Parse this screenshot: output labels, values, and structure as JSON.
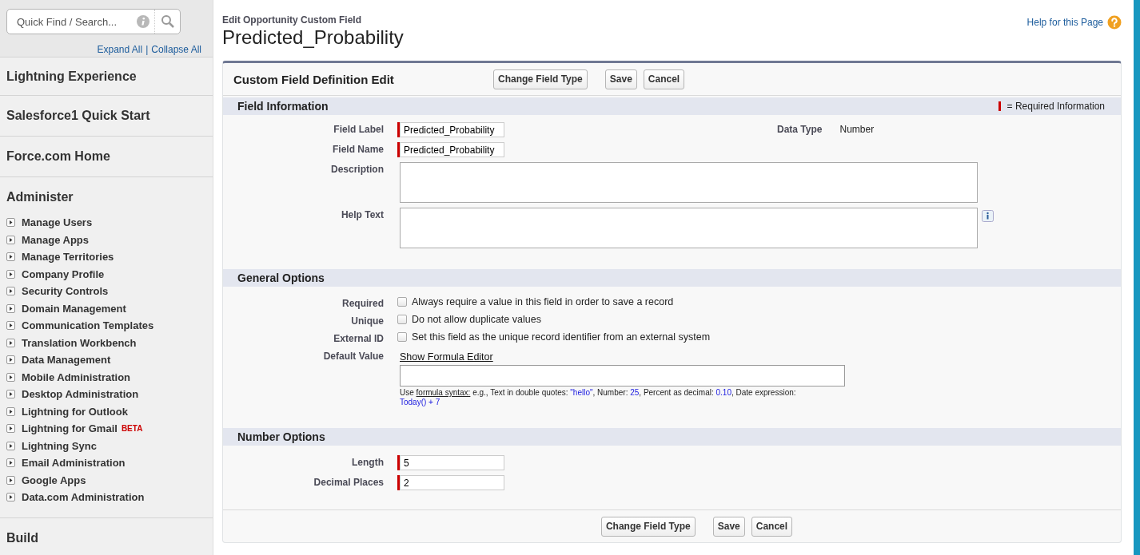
{
  "search": {
    "placeholder": "Quick Find / Search..."
  },
  "tree_links": {
    "expand": "Expand All",
    "separator": "|",
    "collapse": "Collapse All"
  },
  "sidebar": {
    "sections": [
      {
        "title": "Lightning Experience"
      },
      {
        "title": "Salesforce1 Quick Start"
      },
      {
        "title": "Force.com Home"
      },
      {
        "title": "Administer",
        "items": [
          {
            "label": "Manage Users"
          },
          {
            "label": "Manage Apps"
          },
          {
            "label": "Manage Territories"
          },
          {
            "label": "Company Profile"
          },
          {
            "label": "Security Controls"
          },
          {
            "label": "Domain Management"
          },
          {
            "label": "Communication Templates"
          },
          {
            "label": "Translation Workbench"
          },
          {
            "label": "Data Management"
          },
          {
            "label": "Mobile Administration"
          },
          {
            "label": "Desktop Administration"
          },
          {
            "label": "Lightning for Outlook"
          },
          {
            "label": "Lightning for Gmail",
            "badge": "BETA"
          },
          {
            "label": "Lightning Sync"
          },
          {
            "label": "Email Administration"
          },
          {
            "label": "Google Apps"
          },
          {
            "label": "Data.com Administration"
          }
        ]
      },
      {
        "title": "Build"
      }
    ]
  },
  "header": {
    "subtitle": "Edit Opportunity Custom Field",
    "title": "Predicted_Probability",
    "help_link": "Help for this Page"
  },
  "panel": {
    "title": "Custom Field Definition Edit",
    "buttons": [
      "Change Field Type",
      "Save",
      "Cancel"
    ],
    "sections": [
      {
        "title": "Field Information",
        "legend": "= Required Information",
        "rows": [
          {
            "kind": "text",
            "label": "Field Label",
            "value": "Predicted_Probability",
            "required": true,
            "side_label": "Data Type",
            "side_value": "Number"
          },
          {
            "kind": "text",
            "label": "Field Name",
            "value": "Predicted_Probability",
            "required": true
          },
          {
            "kind": "textarea",
            "label": "Description",
            "help_icon": false
          },
          {
            "kind": "textarea",
            "label": "Help Text",
            "help_icon": true
          }
        ]
      },
      {
        "title": "General Options",
        "rows": [
          {
            "kind": "checkbox",
            "label": "Required",
            "text": "Always require a value in this field in order to save a record",
            "checked": false
          },
          {
            "kind": "checkbox",
            "label": "Unique",
            "text": "Do not allow duplicate values",
            "checked": false
          },
          {
            "kind": "checkbox",
            "label": "External ID",
            "text": "Set this field as the unique record identifier from an external system",
            "checked": false
          },
          {
            "kind": "formula",
            "label": "Default Value",
            "link": "Show Formula Editor",
            "hint": [
              {
                "kind": "plain",
                "text": "Use "
              },
              {
                "kind": "link",
                "text": "formula syntax:"
              },
              {
                "kind": "plain",
                "text": " e.g., Text in double quotes: "
              },
              {
                "kind": "code",
                "text": "\"hello\""
              },
              {
                "kind": "plain",
                "text": ", Number: "
              },
              {
                "kind": "code",
                "text": "25"
              },
              {
                "kind": "plain",
                "text": ", Percent as decimal: "
              },
              {
                "kind": "code",
                "text": "0.10"
              },
              {
                "kind": "plain",
                "text": ", Date expression: "
              },
              {
                "kind": "code",
                "text": "Today() + 7"
              }
            ]
          }
        ]
      },
      {
        "title": "Number Options",
        "rows": [
          {
            "kind": "text",
            "label": "Length",
            "value": "5",
            "required": true
          },
          {
            "kind": "text",
            "label": "Decimal Places",
            "value": "2",
            "required": true
          }
        ]
      }
    ],
    "bottom_buttons": [
      "Change Field Type",
      "Save",
      "Cancel"
    ]
  }
}
